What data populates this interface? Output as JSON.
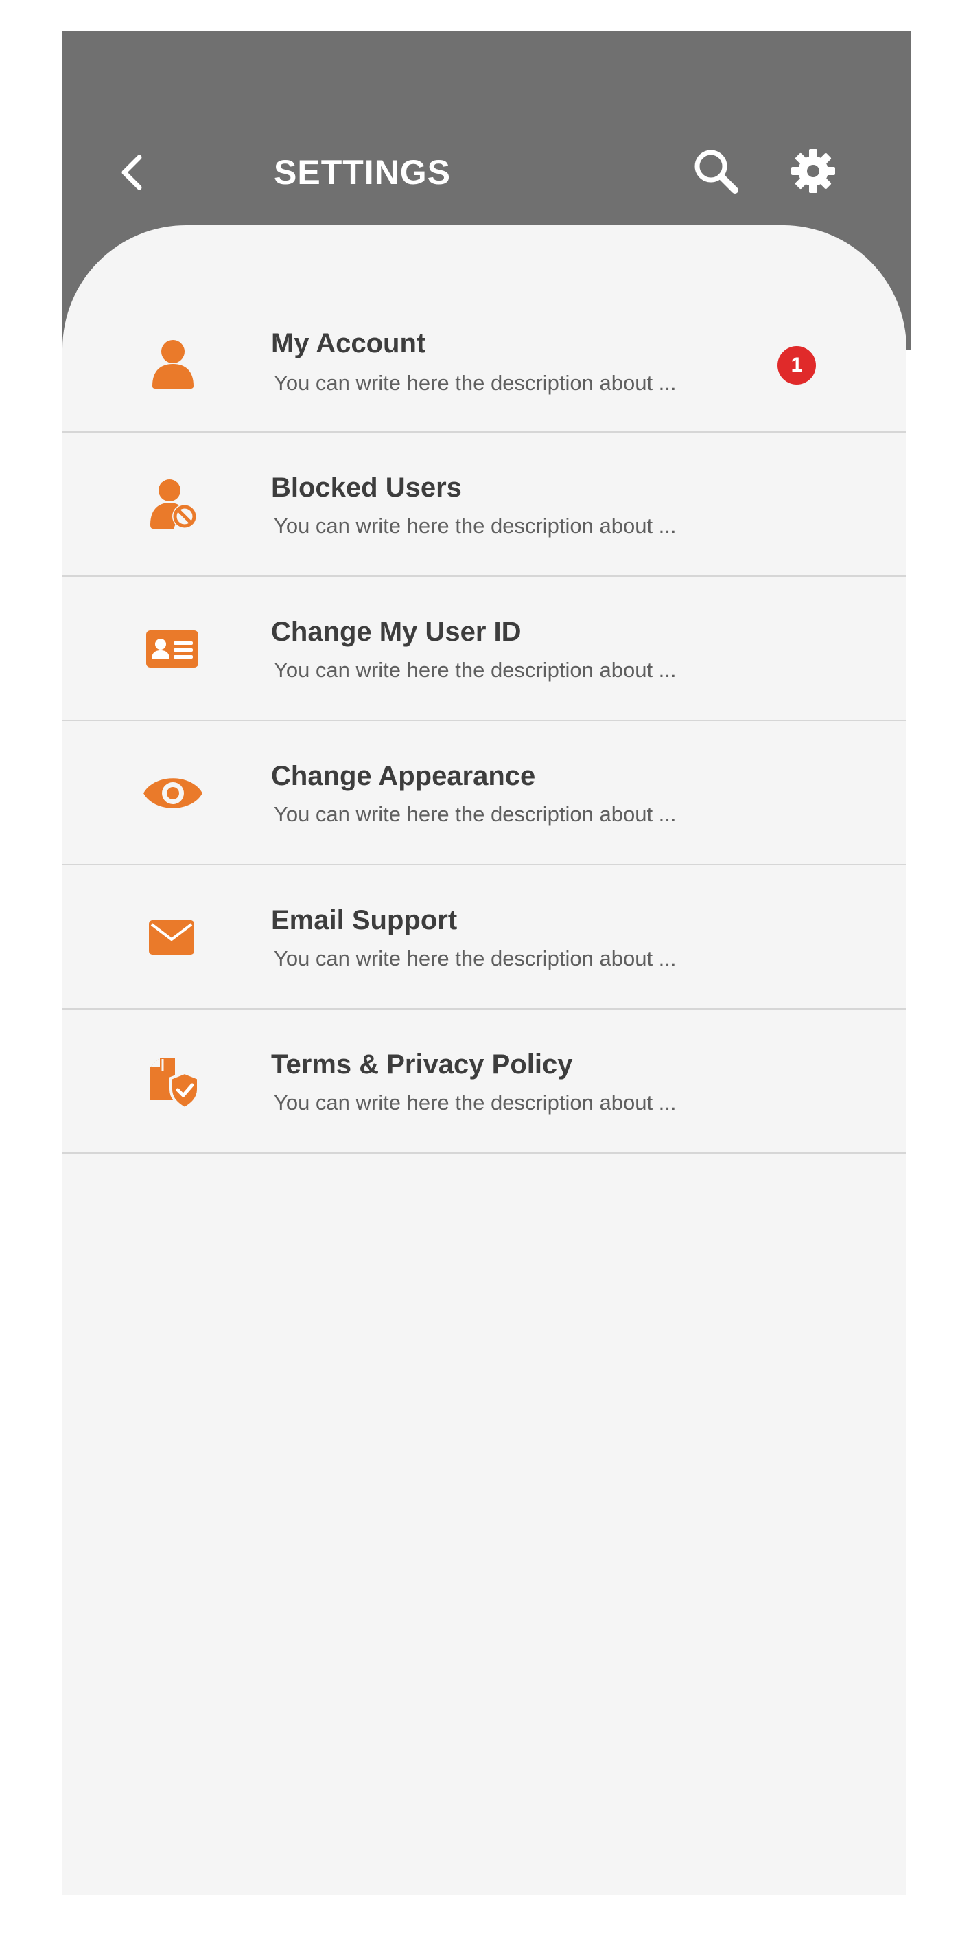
{
  "header": {
    "title": "SETTINGS",
    "background_color": "#707070",
    "icons": [
      "back-icon",
      "search-icon",
      "gear-icon"
    ]
  },
  "accent_color": "#ea7a2a",
  "badge_color": "#e02a2a",
  "settings": {
    "items": [
      {
        "title": "My Account",
        "description": "You can write here the description about ...",
        "icon": "user-icon",
        "badge": "1"
      },
      {
        "title": "Blocked Users",
        "description": "You can write here the description about ...",
        "icon": "user-blocked-icon"
      },
      {
        "title": "Change My User ID",
        "description": "You can write here the description about ...",
        "icon": "id-card-icon"
      },
      {
        "title": "Change Appearance",
        "description": "You can write here the description about ...",
        "icon": "eye-icon"
      },
      {
        "title": "Email Support",
        "description": "You can write here the description about ...",
        "icon": "envelope-icon"
      },
      {
        "title": "Terms & Privacy Policy",
        "description": "You can write here the description about ...",
        "icon": "document-shield-icon"
      }
    ]
  }
}
